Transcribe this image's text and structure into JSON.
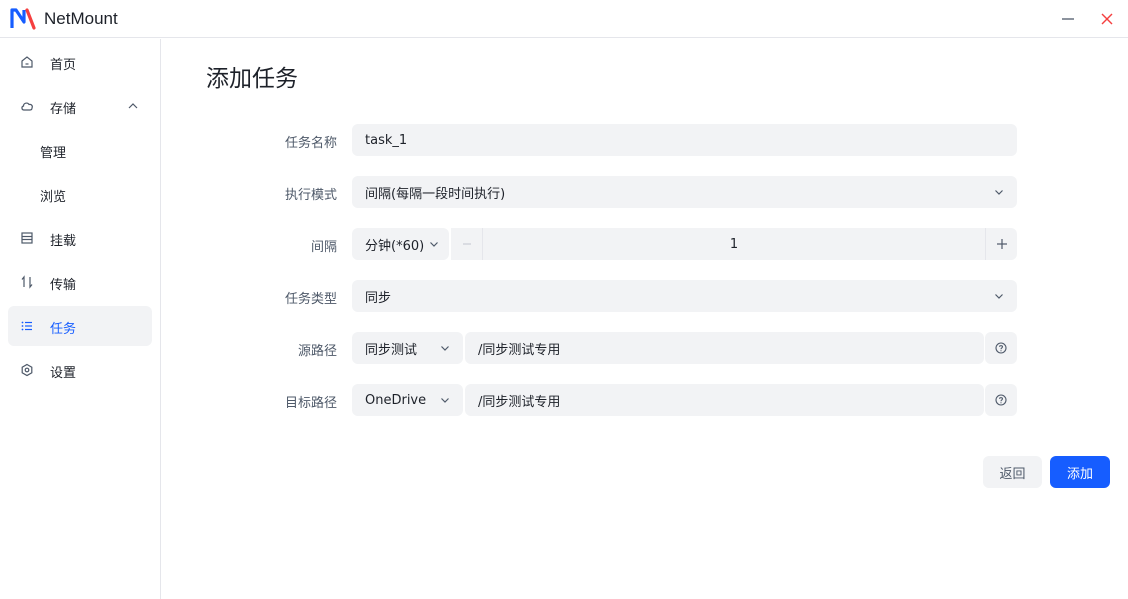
{
  "app": {
    "title": "NetMount"
  },
  "sidebar": {
    "items": [
      {
        "label": "首页",
        "icon": "home-icon"
      },
      {
        "label": "存储",
        "icon": "cloud-icon",
        "expanded": true
      },
      {
        "label": "管理"
      },
      {
        "label": "浏览"
      },
      {
        "label": "挂载",
        "icon": "mount-list-icon"
      },
      {
        "label": "传输",
        "icon": "transfer-arrows-icon"
      },
      {
        "label": "任务",
        "icon": "task-list-icon",
        "active": true
      },
      {
        "label": "设置",
        "icon": "gear-icon"
      }
    ]
  },
  "page": {
    "title": "添加任务"
  },
  "form": {
    "task_name": {
      "label": "任务名称",
      "value": "task_1"
    },
    "exec_mode": {
      "label": "执行模式",
      "value": "间隔(每隔一段时间执行)"
    },
    "interval": {
      "label": "间隔",
      "unit": "分钟(*60)",
      "value": "1"
    },
    "task_type": {
      "label": "任务类型",
      "value": "同步"
    },
    "source": {
      "label": "源路径",
      "storage": "同步测试",
      "path": "/同步测试专用"
    },
    "target": {
      "label": "目标路径",
      "storage": "OneDrive",
      "path": "/同步测试专用"
    }
  },
  "actions": {
    "back": "返回",
    "add": "添加"
  },
  "colors": {
    "accent": "#165dff",
    "field_bg": "#f2f3f5",
    "close": "#f53f3f"
  }
}
